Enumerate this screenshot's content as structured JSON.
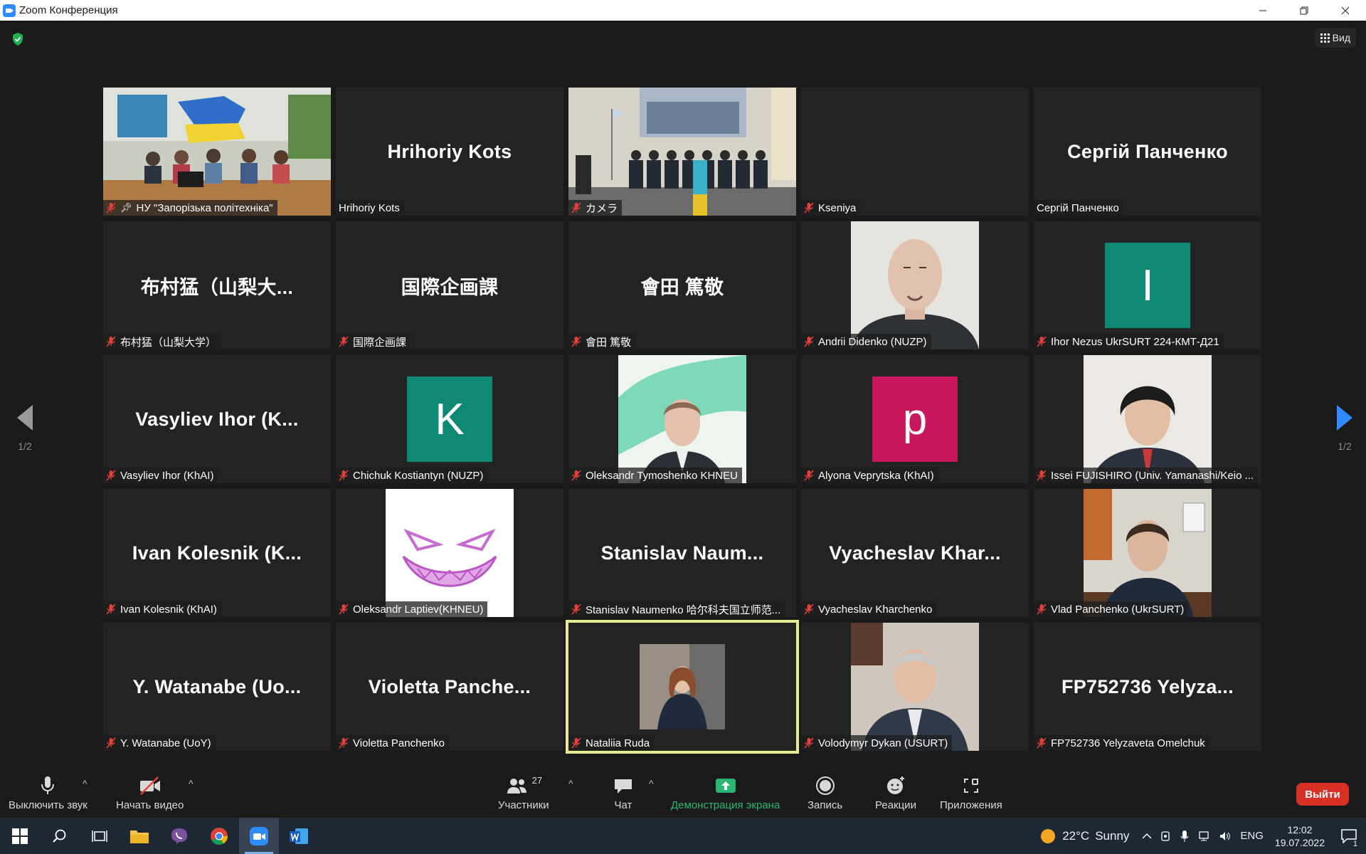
{
  "window": {
    "title": "Zoom Конференция"
  },
  "meeting": {
    "view_label": "Вид",
    "page_indicator_left": "1/2",
    "page_indicator_right": "1/2",
    "tiles": [
      {
        "type": "photo",
        "photo": "room",
        "label": "НУ \"Запорізька політехніка\"",
        "pinned": true
      },
      {
        "type": "name",
        "big": "Hrihoriy Kots",
        "label": "Hrihoriy Kots",
        "muted": false
      },
      {
        "type": "photo",
        "photo": "hall",
        "label": "カメラ"
      },
      {
        "type": "blank",
        "label": "Kseniya"
      },
      {
        "type": "name",
        "big": "Сергій Панченко",
        "label": "Сергій Панченко",
        "muted": false
      },
      {
        "type": "name",
        "big": "布村猛（山梨大...",
        "label": "布村猛（山梨大学）"
      },
      {
        "type": "name",
        "big": "国際企画課",
        "label": "国際企画課"
      },
      {
        "type": "name",
        "big": "會田 篤敬",
        "label": "會田 篤敬"
      },
      {
        "type": "photo",
        "photo": "man1",
        "label": "Andrii Didenko (NUZP)"
      },
      {
        "type": "avatar",
        "letter": "I",
        "color": "#0e8a74",
        "label": "Ihor Nezus UkrSURT 224-КМТ-Д21"
      },
      {
        "type": "name",
        "big": "Vasyliev  Ihor  (K...",
        "label": "Vasyliev Ihor (KhAI)"
      },
      {
        "type": "avatar",
        "letter": "K",
        "color": "#0e8a74",
        "label": "Chichuk Kostiantyn (NUZP)"
      },
      {
        "type": "photo",
        "photo": "man2",
        "label": "Oleksandr Tymoshenko KHNEU"
      },
      {
        "type": "avatar",
        "letter": "p",
        "color": "#c8175d",
        "label": "Alyona Veprytska (KhAI)"
      },
      {
        "type": "photo",
        "photo": "man3",
        "label": "Issei FUJISHIRO (Univ. Yamanashi/Keio ..."
      },
      {
        "type": "name",
        "big": "Ivan  Kolesnik  (K...",
        "label": "Ivan Kolesnik (KhAI)"
      },
      {
        "type": "photo",
        "photo": "smile",
        "label": "Oleksandr Laptiev(KHNEU)"
      },
      {
        "type": "name",
        "big": "Stanislav  Naum...",
        "label": "Stanislav Naumenko 哈尔科夫国立师范..."
      },
      {
        "type": "name",
        "big": "Vyacheslav  Khar...",
        "label": "Vyacheslav Kharchenko"
      },
      {
        "type": "photo",
        "photo": "man4",
        "label": "Vlad Panchenko (UkrSURT)"
      },
      {
        "type": "name",
        "big": "Y.  Watanabe  (Uo...",
        "label": "Y. Watanabe (UoY)"
      },
      {
        "type": "name",
        "big": "Violetta  Panche...",
        "label": "Violetta Panchenko"
      },
      {
        "type": "photo",
        "photo": "woman",
        "label": "Nataliia Ruda",
        "active": true
      },
      {
        "type": "photo",
        "photo": "man5",
        "label": "Volodymyr Dykan (USURT)"
      },
      {
        "type": "name",
        "big": "FP752736  Yelyza...",
        "label": "FP752736 Yelyzaveta Omelchuk"
      }
    ]
  },
  "toolbar": {
    "mute_label": "Выключить звук",
    "video_label": "Начать видео",
    "participants_label": "Участники",
    "participants_count": "27",
    "chat_label": "Чат",
    "share_label": "Демонстрация экрана",
    "record_label": "Запись",
    "reactions_label": "Реакции",
    "apps_label": "Приложения",
    "leave_label": "Выйти",
    "share_color": "#2bb673",
    "leave_color": "#d93025"
  },
  "taskbar": {
    "weather_temp": "22°C",
    "weather_text": "Sunny",
    "language": "ENG",
    "time": "12:02",
    "date": "19.07.2022",
    "notification_count": "1"
  }
}
